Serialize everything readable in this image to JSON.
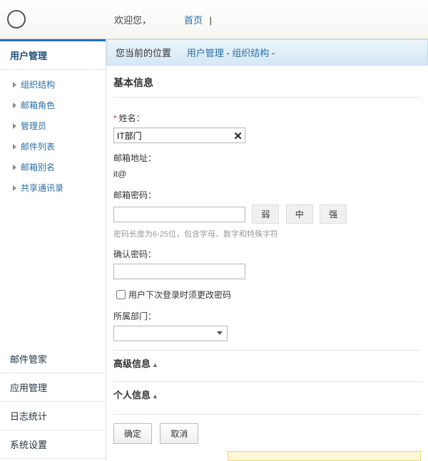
{
  "header": {
    "welcome": "欢迎您，",
    "nav_home": "首页",
    "nav_sep": " | "
  },
  "sidebar": {
    "main_tab": "用户管理",
    "items": [
      "组织结构",
      "邮箱角色",
      "管理员",
      "邮件列表",
      "邮箱别名",
      "共享通讯录"
    ],
    "bottom": [
      "邮件管家",
      "应用管理",
      "日志统计",
      "系统设置"
    ]
  },
  "breadcrumb": {
    "label": "您当前的位置",
    "p1": "用户管理",
    "sep": " - ",
    "p2": "组织结构",
    "p3": ""
  },
  "form": {
    "section_basic": "基本信息",
    "name_label": "姓名：",
    "name_value": "IT部门",
    "email_label": "邮箱地址：",
    "email_value": "it@",
    "pwd_label": "邮箱密码：",
    "pwd_value": "",
    "strength_weak": "弱",
    "strength_mid": "中",
    "strength_strong": "强",
    "pwd_hint": "密码长度为6-25位，包含字母、数字和特殊字符",
    "confirm_label": "确认密码：",
    "confirm_value": "",
    "change_next_login": "用户下次登录时须更改密码",
    "dept_label": "所属部门：",
    "dept_value": "",
    "section_advanced": "高级信息",
    "section_personal": "个人信息"
  },
  "actions": {
    "ok": "确定",
    "cancel": "取消"
  }
}
